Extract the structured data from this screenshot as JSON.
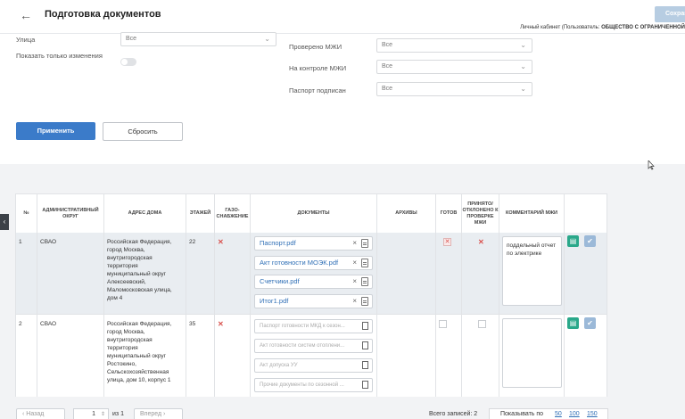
{
  "header": {
    "back_icon": "arrow-left-icon",
    "title": "Подготовка документов",
    "save_label": "Сохранить",
    "cabinet_prefix": "Личный кабинет (Пользователь: ",
    "cabinet_org": "ОБЩЕСТВО С ОГРАНИЧЕННОЙ"
  },
  "filters": {
    "street_label": "Улица",
    "street_value": "Все",
    "changes_label": "Показать только изменения",
    "checked_mzhi_label": "Проверено МЖИ",
    "checked_mzhi_value": "Все",
    "control_mzhi_label": "На контроле МЖИ",
    "control_mzhi_value": "Все",
    "passport_signed_label": "Паспорт подписан",
    "passport_signed_value": "Все",
    "apply_label": "Применить",
    "reset_label": "Сбросить"
  },
  "table": {
    "columns": {
      "num": "№",
      "district": "Административный округ",
      "address": "Адрес дома",
      "floors": "Этажей",
      "gas": "Газо-снабжение",
      "documents": "Документы",
      "archives": "Архивы",
      "ready": "Готов",
      "accepted": "Принято/ отклонено к проверке МЖИ",
      "comment": "Комментарий МЖИ"
    },
    "rows": [
      {
        "num": "1",
        "district": "СВАО",
        "address": "Российская Федерация, город Москва, внутригородская территория муниципальный округ Алексеевский, Маломосковская улица, дом 4",
        "floors": "22",
        "documents": [
          "Паспорт.pdf",
          "Акт готовности МОЭК.pdf",
          "Счетчики.pdf",
          "Итог1.pdf"
        ],
        "comment": "поддельный отчет по электрике"
      },
      {
        "num": "2",
        "district": "СВАО",
        "address": "Российская Федерация, город Москва, внутригородская территория муниципальный округ Ростокино, Сельскохозяйственная улица, дом 10, корпус 1",
        "floors": "35",
        "documents": [
          "Паспорт готовности МКД к сезон...",
          "Акт готовности систем отоплени...",
          "Акт допуска УУ",
          "Прочие документы по сезонной ..."
        ],
        "comment": ""
      }
    ]
  },
  "pager": {
    "prev_label": "Назад",
    "page_value": "1",
    "of_label": "из 1",
    "next_label": "Вперед",
    "total_label": "Всего записей: 2",
    "per_page_label": "Показывать по",
    "size_50": "50",
    "size_100": "100",
    "size_150": "150"
  },
  "colors": {
    "accent": "#3b7bc9",
    "green_action": "#2aa88a",
    "error": "#d9534f"
  }
}
